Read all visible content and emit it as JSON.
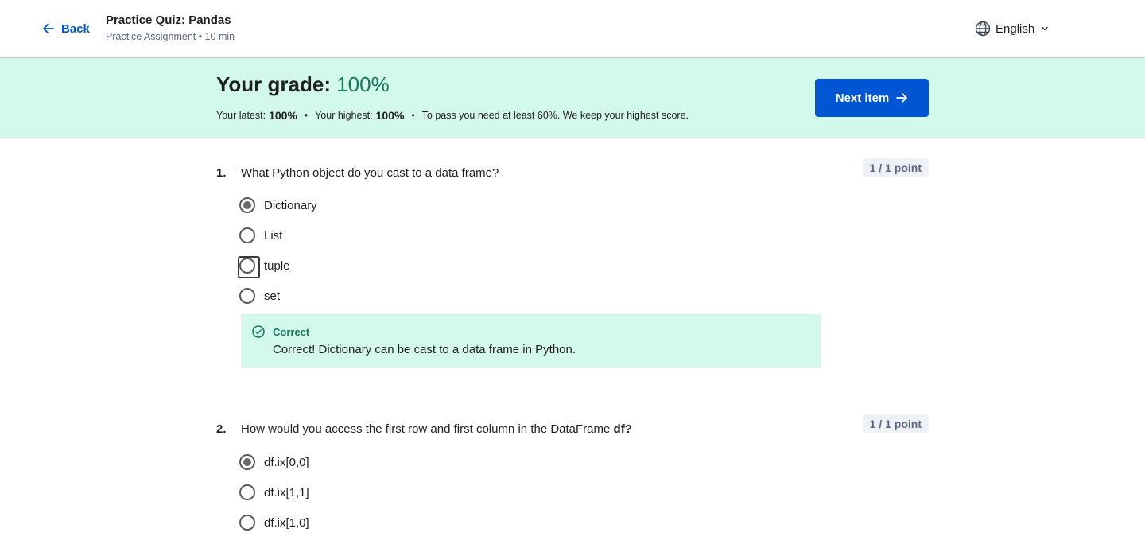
{
  "header": {
    "back_label": "Back",
    "title": "Practice Quiz: Pandas",
    "subtitle": "Practice Assignment • 10 min",
    "language": "English"
  },
  "grade": {
    "title_prefix": "Your grade: ",
    "title_value": "100%",
    "latest_label": "Your latest:",
    "latest_value": "100%",
    "highest_label": "Your highest:",
    "highest_value": "100%",
    "pass_text": "To pass you need at least 60%. We keep your highest score.",
    "next_label": "Next item"
  },
  "questions": [
    {
      "number": "1.",
      "text": "What Python object do you cast to a data frame?",
      "points": "1 / 1 point",
      "options": [
        "Dictionary",
        "List",
        "tuple",
        "set"
      ],
      "selected": "Dictionary",
      "feedback_title": "Correct",
      "feedback_text": "Correct! Dictionary can be cast to a data frame in Python."
    },
    {
      "number": "2.",
      "text_prefix": "How would you access the first row and first column in the DataFrame ",
      "text_bold": "df?",
      "points": "1 / 1 point",
      "options": [
        "df.ix[0,0]",
        "df.ix[1,1]",
        "df.ix[1,0]"
      ],
      "selected": "df.ix[0,0]"
    }
  ],
  "colors": {
    "accent": "#0056d2",
    "success": "#137a5c",
    "success_bg": "#d3f8ec"
  },
  "icons": [
    "arrow-left-icon",
    "globe-icon",
    "chevron-down-icon",
    "arrow-right-icon",
    "check-circle-icon"
  ]
}
